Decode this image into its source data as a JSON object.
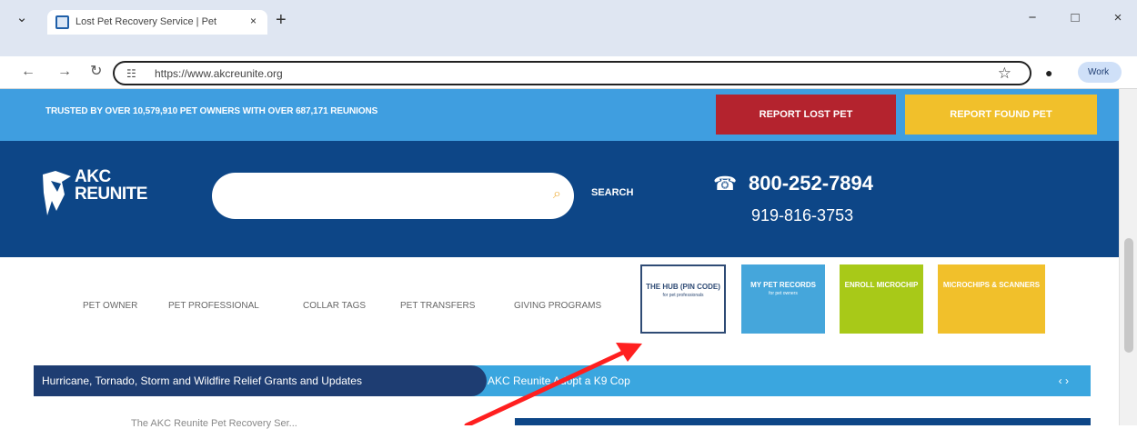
{
  "browser": {
    "tab_title": "Lost Pet Recovery Service | Pet",
    "url": "https://www.akcreunite.org",
    "profile_label": "Work"
  },
  "page": {
    "trust_text": "TRUSTED BY OVER 10,579,910 PET OWNERS WITH OVER 687,171 REUNIONS",
    "report_lost": "REPORT LOST PET",
    "report_found": "REPORT FOUND PET",
    "logo_line1": "AKC",
    "logo_line2": "REUNITE",
    "search_label": "SEARCH",
    "phone_primary": "800-252-7894",
    "phone_secondary": "919-816-3753",
    "menu": [
      "PET OWNER",
      "PET PROFESSIONAL",
      "COLLAR TAGS",
      "PET TRANSFERS",
      "GIVING PROGRAMS"
    ],
    "tiles": [
      {
        "title": "THE HUB (PIN CODE)",
        "subtitle": "for pet professionals"
      },
      {
        "title": "MY PET RECORDS",
        "subtitle": "for pet owners"
      },
      {
        "title": "ENROLL MICROCHIP",
        "subtitle": ""
      },
      {
        "title": "MICROCHIPS & SCANNERS",
        "subtitle": ""
      }
    ],
    "news_title": "Hurricane, Tornado, Storm and Wildfire Relief Grants and Updates",
    "news_item": "AKC Reunite Adopt a K9 Cop",
    "bottom_partial": "The AKC Reunite Pet Recovery Ser..."
  },
  "colors": {
    "accent_blue": "#0d4687",
    "light_blue": "#3f9ee0",
    "red_button": "#b4232e",
    "yellow_button": "#f1c02b",
    "green_tile": "#a8c918",
    "annotation_arrow": "#ff1f1f"
  }
}
